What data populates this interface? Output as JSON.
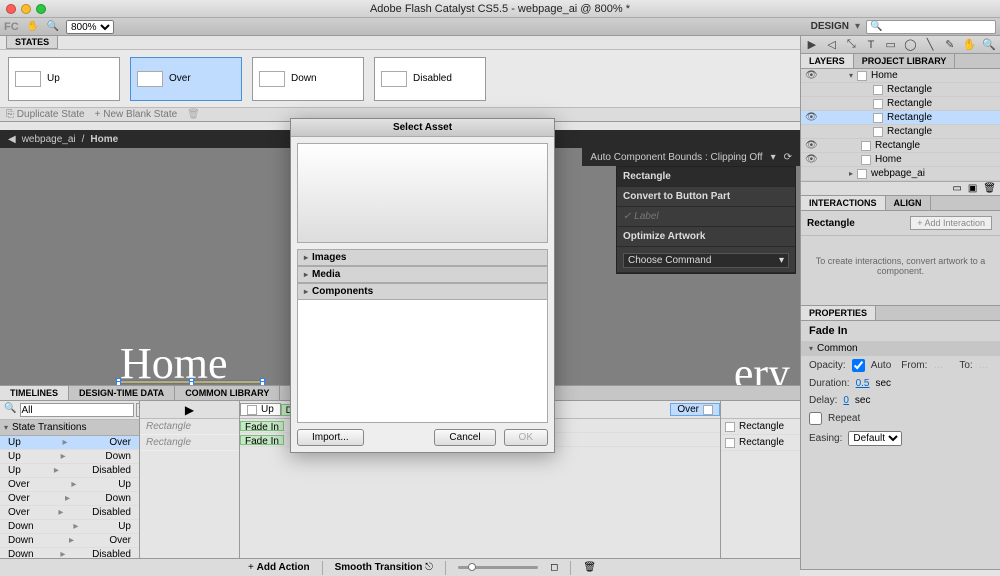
{
  "titlebar": {
    "title": "Adobe Flash Catalyst CS5.5 - webpage_ai @ 800% *"
  },
  "apptb": {
    "zoom": "800%",
    "design_label": "DESIGN"
  },
  "states": {
    "tab": "STATES",
    "items": [
      {
        "label": "Up",
        "color": "#b5231f"
      },
      {
        "label": "Over",
        "color": "#2d6fd2",
        "selected": true
      },
      {
        "label": "Down",
        "color": "#35a636"
      },
      {
        "label": "Disabled",
        "color": "#1b2ea0"
      }
    ],
    "dup": "Duplicate State",
    "newb": "New Blank State"
  },
  "path": {
    "back_aria": "back",
    "doc": "webpage_ai",
    "sep": "/",
    "page": "Home"
  },
  "hudbar": {
    "label": "Auto Component Bounds : Clipping Off"
  },
  "hud": {
    "title": "Rectangle",
    "convert": "Convert to Button Part",
    "label_opt": "Label",
    "opt_title": "Optimize Artwork",
    "cmd": "Choose Command"
  },
  "canvas": {
    "home": "Home",
    "ery": "ery"
  },
  "layers": {
    "tab1": "LAYERS",
    "tab2": "PROJECT LIBRARY",
    "rows": [
      {
        "type": "group",
        "label": "Home",
        "indent": 1,
        "eye": true
      },
      {
        "type": "item",
        "label": "Rectangle",
        "indent": 3,
        "eye": false
      },
      {
        "type": "item",
        "label": "Rectangle",
        "indent": 3,
        "eye": false
      },
      {
        "type": "item",
        "label": "Rectangle",
        "indent": 3,
        "eye": true,
        "selected": true
      },
      {
        "type": "item",
        "label": "Rectangle",
        "indent": 3,
        "eye": false
      },
      {
        "type": "item",
        "label": "Rectangle",
        "indent": 2,
        "eye": true
      },
      {
        "type": "item",
        "label": "Home",
        "indent": 2,
        "eye": true
      },
      {
        "type": "group",
        "label": "webpage_ai",
        "indent": 1,
        "eye": false,
        "collapsed": true
      }
    ]
  },
  "interactions": {
    "tab1": "INTERACTIONS",
    "tab2": "ALIGN",
    "target": "Rectangle",
    "add": "+  Add Interaction",
    "msg": "To create interactions, convert artwork to a component."
  },
  "properties": {
    "tab": "PROPERTIES",
    "title": "Fade In",
    "section": "Common",
    "opacity": "Opacity:",
    "auto": "Auto",
    "from": "From:",
    "to": "To:",
    "duration": "Duration:",
    "duration_v": "0.5",
    "sec": "sec",
    "delay": "Delay:",
    "delay_v": "0",
    "repeat": "Repeat",
    "easing": "Easing:",
    "easing_v": "Default"
  },
  "timelines": {
    "tab1": "TIMELINES",
    "tab2": "DESIGN-TIME DATA",
    "tab3": "COMMON LIBRARY",
    "filter": "All",
    "st_header": "State Transitions",
    "rows": [
      {
        "from": "Up",
        "to": "Over",
        "selected": true
      },
      {
        "from": "Up",
        "to": "Down"
      },
      {
        "from": "Up",
        "to": "Disabled"
      },
      {
        "from": "Over",
        "to": "Up"
      },
      {
        "from": "Over",
        "to": "Down"
      },
      {
        "from": "Over",
        "to": "Disabled"
      },
      {
        "from": "Down",
        "to": "Up"
      },
      {
        "from": "Down",
        "to": "Over"
      },
      {
        "from": "Down",
        "to": "Disabled"
      }
    ],
    "mid": {
      "r1": "Rectangle",
      "r2": "Rectangle"
    },
    "upchip": "Up",
    "dschip": "Ds",
    "ovchip": "Over",
    "fade": "Fade In",
    "right": {
      "r1": "Rectangle",
      "r2": "Rectangle"
    },
    "foot": {
      "add": "Add Action",
      "smooth": "Smooth Transition"
    }
  },
  "dialog": {
    "title": "Select Asset",
    "acc1": "Images",
    "acc2": "Media",
    "acc3": "Components",
    "import": "Import...",
    "cancel": "Cancel",
    "ok": "OK"
  }
}
